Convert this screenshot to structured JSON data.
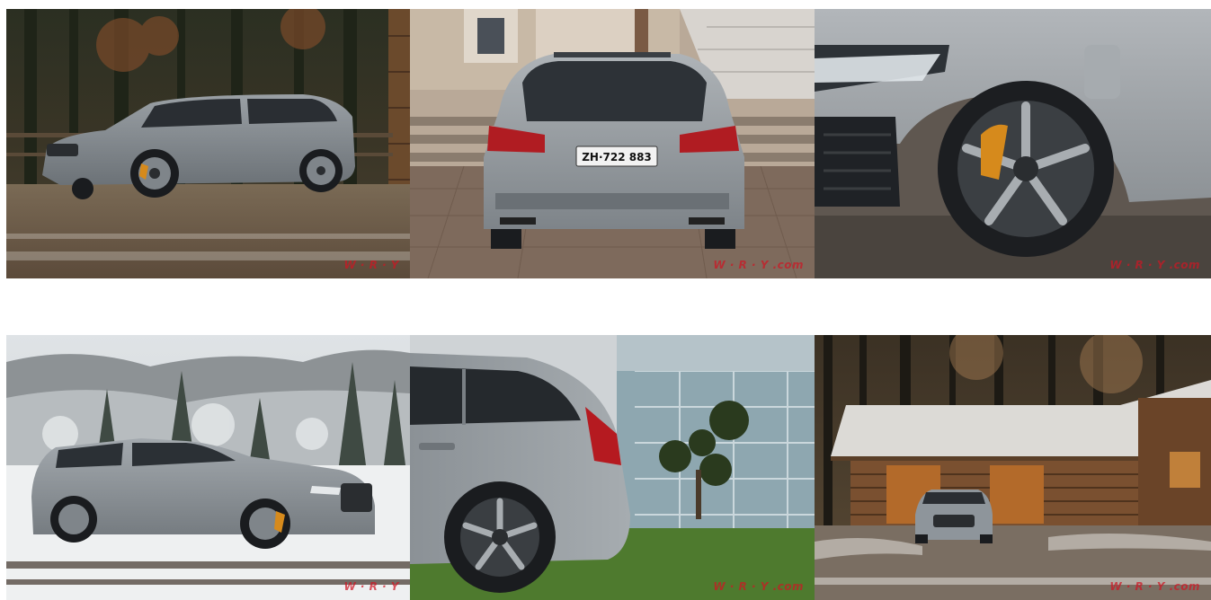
{
  "gallery": {
    "photos": [
      {
        "subject": "front-three-quarter-forest",
        "watermark": "W · R · Y"
      },
      {
        "subject": "rear-view-plate",
        "plate": "ZH·722 883",
        "watermark": "W · R · Y .com"
      },
      {
        "subject": "front-wheel-closeup",
        "watermark": "W · R · Y .com"
      },
      {
        "subject": "side-view-snow",
        "watermark": "W · R · Y"
      },
      {
        "subject": "rear-quarter-glass-building",
        "watermark": "W · R · Y .com"
      },
      {
        "subject": "front-view-log-cabin",
        "watermark": "W · R · Y .com"
      }
    ]
  },
  "colors": {
    "car_grey": "#8e959b",
    "brake_caliper": "#d68a1c",
    "watermark_red": "#cd1624"
  }
}
